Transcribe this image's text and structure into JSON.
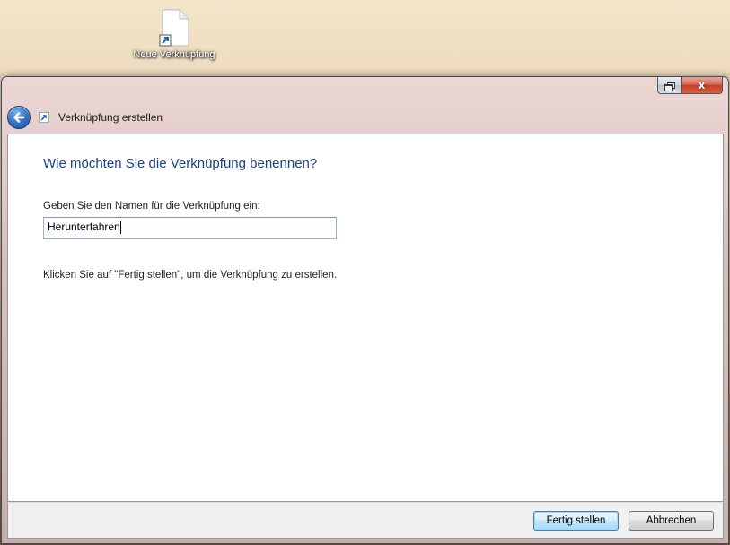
{
  "desktop": {
    "shortcut_label": "Neue Verknüpfung"
  },
  "window": {
    "caption_close_symbol": "x",
    "nav_title": "Verknüpfung erstellen"
  },
  "main": {
    "heading": "Wie möchten Sie die Verknüpfung benennen?",
    "name_label": "Geben Sie den Namen für die Verknüpfung ein:",
    "name_value": "Herunterfahren",
    "finish_hint": "Klicken Sie auf \"Fertig stellen\", um die Verknüpfung zu erstellen."
  },
  "footer": {
    "finish_label": "Fertig stellen",
    "cancel_label": "Abbrechen"
  },
  "icons": [
    "shortcut-file-icon",
    "back-arrow-icon",
    "shortcut-wizard-icon",
    "restore-icon",
    "close-icon"
  ],
  "colors": {
    "heading": "#1a3e8a",
    "close_button": "#c2402a",
    "back_button": "#2f6fc2"
  }
}
